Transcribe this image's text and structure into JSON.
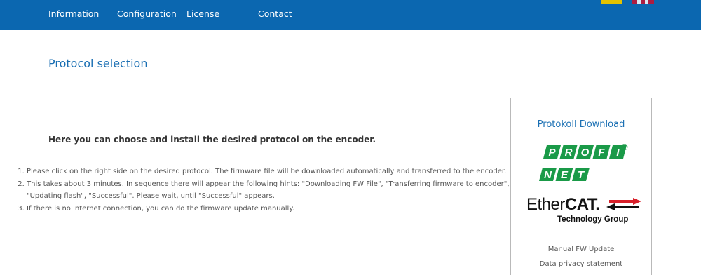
{
  "nav": {
    "items": [
      {
        "label": "Information"
      },
      {
        "label": "Configuration"
      },
      {
        "label": "License"
      },
      {
        "label": "Contact"
      }
    ]
  },
  "page": {
    "title": "Protocol selection",
    "intro": "Here you can choose and install the desired protocol on the encoder.",
    "steps": [
      "Please click on the right side on the desired protocol. The firmware file will be downloaded automatically and transferred to the encoder.",
      "This takes about 3 minutes. In sequence there will appear the following hints: \"Downloading FW File\", \"Transferring firmware to encoder\", \"Updating flash\", \"Successful\". Please wait, until \"Successful\" appears.",
      "If there is no internet connection, you can do the firmware update manually."
    ]
  },
  "download_box": {
    "title": "Protokoll Download",
    "profinet_logo_text": [
      "PROFI",
      "NET"
    ],
    "profinet_registered": "®",
    "ethercat_logo_text": {
      "main_light": "Ether",
      "main_bold": "CAT",
      "dot": ".",
      "sub": "Technology Group"
    },
    "manual_link": "Manual FW Update",
    "privacy_link": "Data privacy statement"
  },
  "colors": {
    "navbar": "#0b67b0",
    "title_blue": "#1a6fb3",
    "profinet_green": "#1a9a48",
    "ethercat_red": "#d8202a"
  }
}
